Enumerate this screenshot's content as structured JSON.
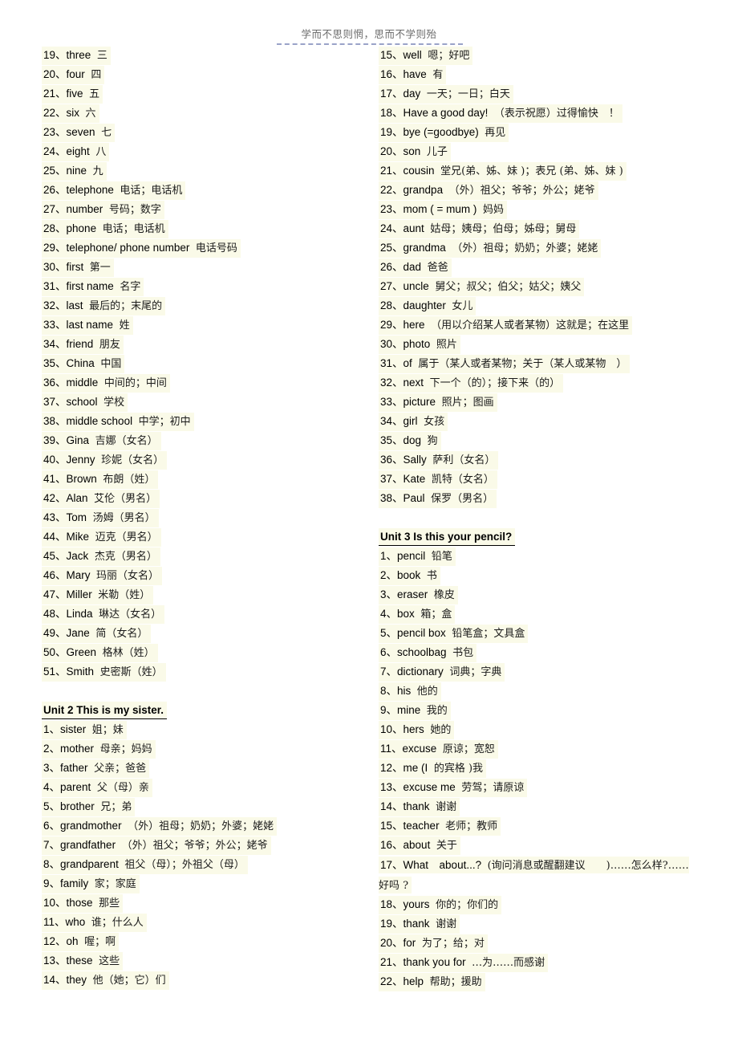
{
  "page": {
    "header_text": "学而不思则惘，思而不学则殆",
    "highlight_color": "#fafae8",
    "background_color": "#ffffff"
  },
  "left_column": [
    {
      "num": "19、",
      "en": "three",
      "cn": "三"
    },
    {
      "num": "20、",
      "en": "four",
      "cn": "四"
    },
    {
      "num": "21、",
      "en": "five",
      "cn": "五"
    },
    {
      "num": "22、",
      "en": "six",
      "cn": "六"
    },
    {
      "num": "23、",
      "en": "seven",
      "cn": "七"
    },
    {
      "num": "24、",
      "en": "eight",
      "cn": "八"
    },
    {
      "num": "25、",
      "en": "nine",
      "cn": "九"
    },
    {
      "num": "26、",
      "en": "telephone",
      "cn": "电话；电话机"
    },
    {
      "num": "27、",
      "en": "number",
      "cn": "号码；数字"
    },
    {
      "num": "28、",
      "en": "phone",
      "cn": "电话；电话机"
    },
    {
      "num": "29、",
      "en": "telephone/ phone number",
      "cn": "电话号码"
    },
    {
      "num": "30、",
      "en": "first",
      "cn": "第一"
    },
    {
      "num": "31、",
      "en": "first name",
      "cn": "名字"
    },
    {
      "num": "32、",
      "en": "last",
      "cn": "最后的；末尾的"
    },
    {
      "num": "33、",
      "en": "last name",
      "cn": "姓"
    },
    {
      "num": "34、",
      "en": "friend",
      "cn": "朋友"
    },
    {
      "num": "35、",
      "en": "China",
      "cn": "中国"
    },
    {
      "num": "36、",
      "en": "middle",
      "cn": "中间的；中间"
    },
    {
      "num": "37、",
      "en": "school",
      "cn": "学校"
    },
    {
      "num": "38、",
      "en": "middle school",
      "cn": "中学；初中"
    },
    {
      "num": "39、",
      "en": "Gina",
      "cn": "吉娜（女名）"
    },
    {
      "num": "40、",
      "en": "Jenny",
      "cn": "珍妮（女名）"
    },
    {
      "num": "41、",
      "en": "Brown",
      "cn": "布朗（姓）"
    },
    {
      "num": "42、",
      "en": "Alan",
      "cn": "艾伦（男名）"
    },
    {
      "num": "43、",
      "en": "Tom",
      "cn": "汤姆（男名）"
    },
    {
      "num": "44、",
      "en": "Mike",
      "cn": "迈克（男名）"
    },
    {
      "num": "45、",
      "en": "Jack",
      "cn": "杰克（男名）"
    },
    {
      "num": "46、",
      "en": "Mary",
      "cn": "玛丽（女名）"
    },
    {
      "num": "47、",
      "en": "Miller",
      "cn": "米勒（姓）"
    },
    {
      "num": "48、",
      "en": "Linda",
      "cn": "琳达（女名）"
    },
    {
      "num": "49、",
      "en": "Jane",
      "cn": "简（女名）"
    },
    {
      "num": "50、",
      "en": "Green",
      "cn": "格林（姓）"
    },
    {
      "num": "51、",
      "en": "Smith",
      "cn": "史密斯（姓）"
    }
  ],
  "unit2": {
    "heading": "Unit 2 This is my sister.",
    "entries": [
      {
        "num": "1、",
        "en": "sister",
        "cn": "姐；妹"
      },
      {
        "num": "2、",
        "en": "mother",
        "cn": "母亲；妈妈"
      },
      {
        "num": "3、",
        "en": "father",
        "cn": "父亲；爸爸"
      },
      {
        "num": "4、",
        "en": "parent",
        "cn": "父（母）亲"
      },
      {
        "num": "5、",
        "en": "brother",
        "cn": "兄；弟"
      },
      {
        "num": "6、",
        "en": "grandmother",
        "cn": "（外）祖母；奶奶；外婆；姥姥"
      },
      {
        "num": "7、",
        "en": "grandfather",
        "cn": "（外）祖父；爷爷；外公；姥爷"
      },
      {
        "num": "8、",
        "en": "grandparent",
        "cn": "祖父（母）；外祖父（母）"
      },
      {
        "num": "9、",
        "en": "family",
        "cn": "家；家庭"
      },
      {
        "num": "10、",
        "en": "those",
        "cn": "那些"
      },
      {
        "num": "11、",
        "en": "who",
        "cn": "谁；什么人"
      },
      {
        "num": "12、",
        "en": "oh",
        "cn": "喔；啊"
      },
      {
        "num": "13、",
        "en": "these",
        "cn": "这些"
      },
      {
        "num": "14、",
        "en": "they",
        "cn": "他（她；它）们"
      },
      {
        "num": "15、",
        "en": "well",
        "cn": "嗯；好吧"
      },
      {
        "num": "16、",
        "en": "have",
        "cn": "有"
      },
      {
        "num": "17、",
        "en": "day",
        "cn": "一天；一日；白天"
      },
      {
        "num": "18、",
        "en": "Have a good day!",
        "cn": "（表示祝愿）过得愉快　！"
      },
      {
        "num": "19、",
        "en": "bye (=goodbye)",
        "cn": "再见"
      },
      {
        "num": "20、",
        "en": "son",
        "cn": "儿子"
      },
      {
        "num": "21、",
        "en": "cousin",
        "cn": "堂兄(弟、姊、妹 )；表兄 (弟、姊、妹 )"
      },
      {
        "num": "22、",
        "en": "grandpa",
        "cn": "（外）祖父；爷爷；外公；姥爷"
      },
      {
        "num": "23、",
        "en": "mom ( = mum )",
        "cn": "妈妈"
      },
      {
        "num": "24、",
        "en": "aunt",
        "cn": "姑母；姨母；伯母；姊母；舅母"
      },
      {
        "num": "25、",
        "en": "grandma",
        "cn": "（外）祖母；奶奶；外婆；姥姥"
      },
      {
        "num": "26、",
        "en": "dad",
        "cn": "爸爸"
      },
      {
        "num": "27、",
        "en": "uncle",
        "cn": "舅父；叔父；伯父；姑父；姨父"
      },
      {
        "num": "28、",
        "en": "daughter",
        "cn": "女儿"
      },
      {
        "num": "29、",
        "en": "here",
        "cn": "（用以介绍某人或者某物）这就是；在这里"
      },
      {
        "num": "30、",
        "en": "photo",
        "cn": "照片"
      },
      {
        "num": "31、",
        "en": "of",
        "cn": "属于（某人或者某物；关于（某人或某物　）"
      },
      {
        "num": "32、",
        "en": "next",
        "cn": "下一个（的）；接下来（的）"
      },
      {
        "num": "33、",
        "en": "picture",
        "cn": "照片；图画"
      },
      {
        "num": "34、",
        "en": "girl",
        "cn": "女孩"
      },
      {
        "num": "35、",
        "en": "dog",
        "cn": "狗"
      },
      {
        "num": "36、",
        "en": "Sally",
        "cn": "萨利（女名）"
      },
      {
        "num": "37、",
        "en": "Kate",
        "cn": "凯特（女名）"
      },
      {
        "num": "38、",
        "en": "Paul",
        "cn": "保罗（男名）"
      }
    ]
  },
  "unit3": {
    "heading": "Unit 3 Is this your pencil?",
    "entries": [
      {
        "num": "1、",
        "en": "pencil",
        "cn": "铅笔"
      },
      {
        "num": "2、",
        "en": "book",
        "cn": "书"
      },
      {
        "num": "3、",
        "en": "eraser",
        "cn": "橡皮"
      },
      {
        "num": "4、",
        "en": "box",
        "cn": "箱；盒"
      },
      {
        "num": "5、",
        "en": "pencil box",
        "cn": "铅笔盒；文具盒"
      },
      {
        "num": "6、",
        "en": "schoolbag",
        "cn": "书包"
      },
      {
        "num": "7、",
        "en": "dictionary",
        "cn": "词典；字典"
      },
      {
        "num": "8、",
        "en": "his",
        "cn": "他的"
      },
      {
        "num": "9、",
        "en": "mine",
        "cn": "我的"
      },
      {
        "num": "10、",
        "en": "hers",
        "cn": "她的"
      },
      {
        "num": "11、",
        "en": "excuse",
        "cn": "原谅；宽恕"
      },
      {
        "num": "12、",
        "en": "me (I",
        "cn": "的宾格 )我"
      },
      {
        "num": "13、",
        "en": "excuse me",
        "cn": "劳驾；请原谅"
      },
      {
        "num": "14、",
        "en": "thank",
        "cn": "谢谢"
      },
      {
        "num": "15、",
        "en": "teacher",
        "cn": "老师；教师"
      },
      {
        "num": "16、",
        "en": "about",
        "cn": "关于"
      },
      {
        "num": "17、",
        "en": "What　about...?",
        "cn": "(询问消息或醒翻建议　　)……怎么样?……好吗 ?",
        "wrap": true
      },
      {
        "num": "18、",
        "en": "yours",
        "cn": "你的；你们的"
      },
      {
        "num": "19、",
        "en": "thank",
        "cn": "谢谢"
      },
      {
        "num": "20、",
        "en": "for",
        "cn": "为了；给；对"
      },
      {
        "num": "21、",
        "en": "thank you for",
        "cn": "…为……而感谢"
      },
      {
        "num": "22、",
        "en": "help",
        "cn": "帮助；援助"
      }
    ]
  }
}
